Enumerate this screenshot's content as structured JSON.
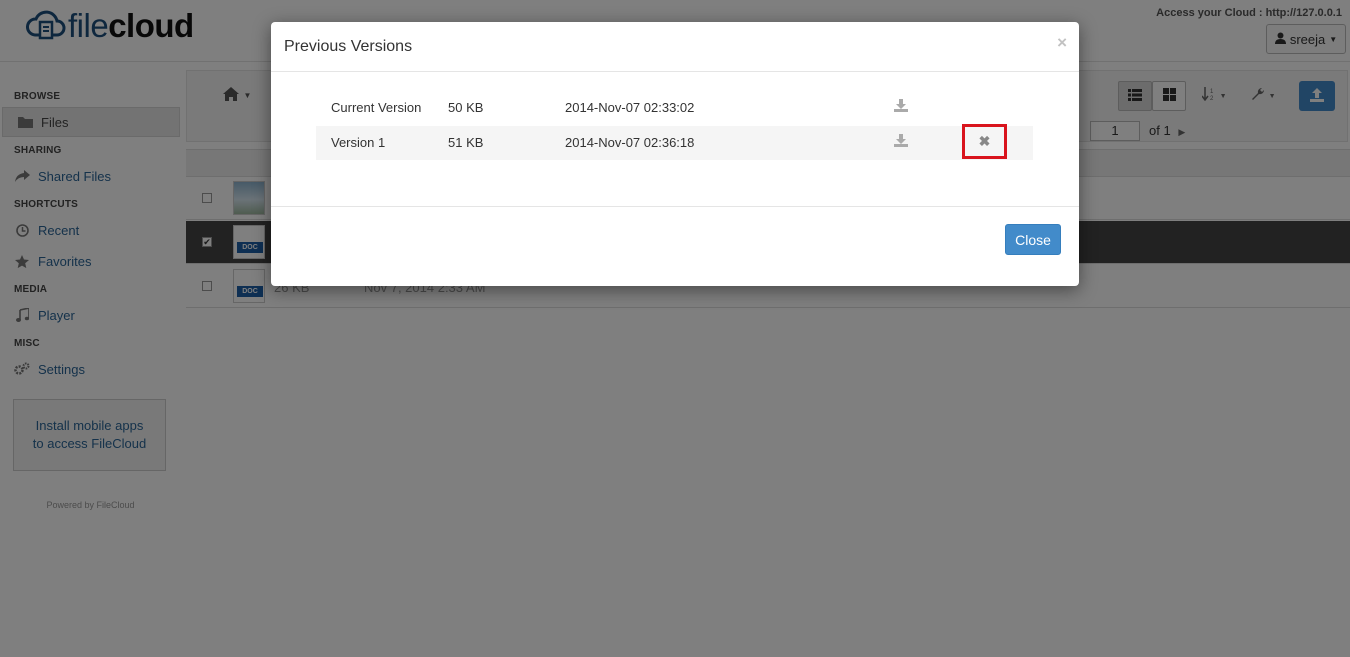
{
  "app": {
    "logo_light": "file",
    "logo_bold": "cloud",
    "access_text": "Access your Cloud : http://127.0.0.1",
    "user_name": "sreeja"
  },
  "sidebar": {
    "browse_head": "BROWSE",
    "files": "Files",
    "sharing_head": "SHARING",
    "shared_files": "Shared Files",
    "shortcuts_head": "SHORTCUTS",
    "recent": "Recent",
    "favorites": "Favorites",
    "media_head": "MEDIA",
    "player": "Player",
    "misc_head": "MISC",
    "settings": "Settings",
    "promo_line1": "Install mobile apps",
    "promo_line2": "to access FileCloud",
    "powered": "Powered by FileCloud"
  },
  "pager": {
    "page_value": "1",
    "page_of": "of 1"
  },
  "files": [
    {
      "thumb": "image",
      "size": "",
      "date": ""
    },
    {
      "thumb": "doc",
      "size": "",
      "date": ""
    },
    {
      "thumb": "doc",
      "size": "26 KB",
      "date": "Nov 7, 2014 2:33 AM"
    }
  ],
  "doc_tag": "DOC",
  "modal": {
    "title": "Previous Versions",
    "close_glyph": "×",
    "close_button": "Close",
    "versions": [
      {
        "name": "Current Version",
        "size": "50 KB",
        "date": "2014-Nov-07 02:33:02"
      },
      {
        "name": "Version 1",
        "size": "51 KB",
        "date": "2014-Nov-07 02:36:18"
      }
    ],
    "delete_glyph": "✖"
  },
  "colors": {
    "primary": "#428bca",
    "highlight": "#d9141d",
    "brand": "#1d4f7c"
  }
}
